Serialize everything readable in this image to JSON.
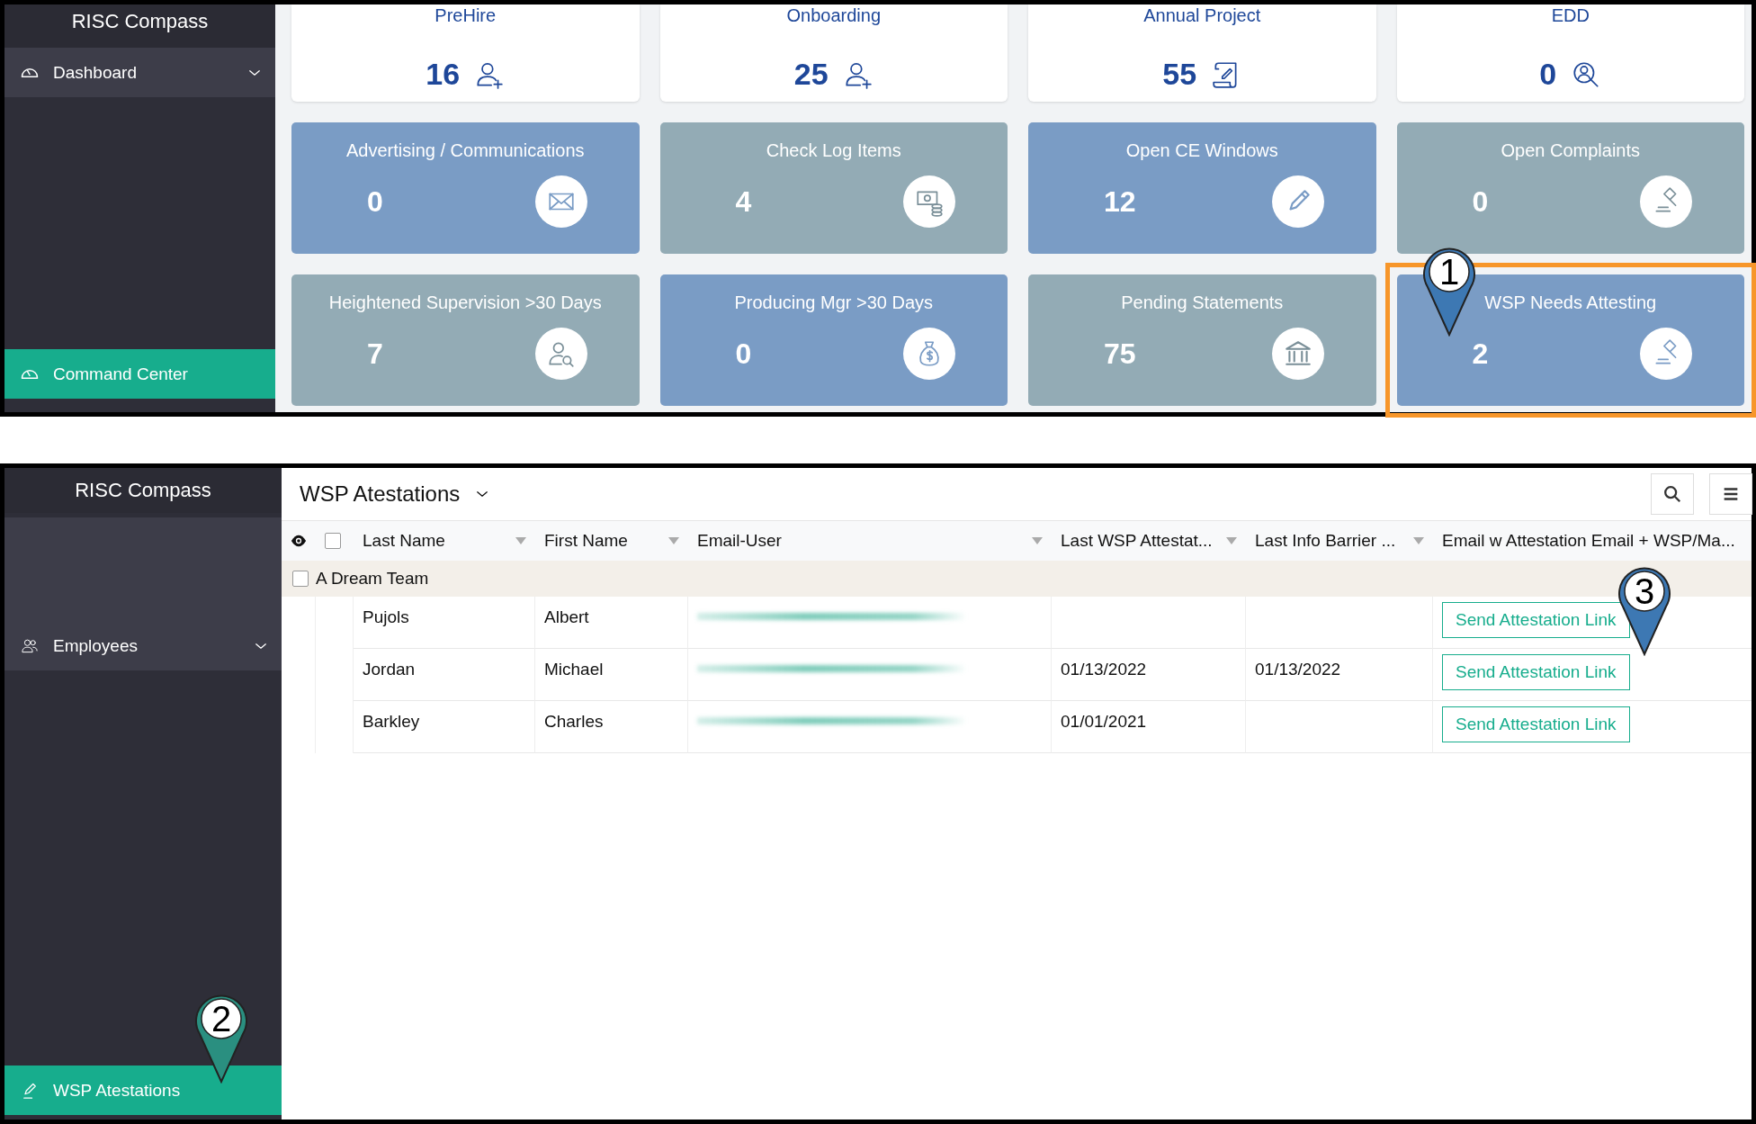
{
  "dashboard": {
    "app_title": "RISC Compass",
    "sidebar": [
      {
        "label": "Dashboard",
        "kind": "group",
        "selected": false
      },
      {
        "label": "Command Center",
        "kind": "link",
        "selected": true
      }
    ],
    "tiles": [
      {
        "title": "PreHire",
        "count": "16",
        "kind": "summary",
        "highlighted": false
      },
      {
        "title": "Onboarding",
        "count": "25",
        "kind": "summary",
        "highlighted": false
      },
      {
        "title": "Annual Project",
        "count": "55",
        "kind": "summary",
        "highlighted": false
      },
      {
        "title": "EDD",
        "count": "0",
        "kind": "summary",
        "highlighted": false
      },
      {
        "title": "Advertising / Communications",
        "count": "0",
        "kind": "tile",
        "color": "#7a9cc5",
        "highlighted": false
      },
      {
        "title": "Check Log Items",
        "count": "4",
        "kind": "tile",
        "color": "#93abb5",
        "highlighted": false
      },
      {
        "title": "Open CE Windows",
        "count": "12",
        "kind": "tile",
        "color": "#7a9cc5",
        "highlighted": false
      },
      {
        "title": "Open Complaints",
        "count": "0",
        "kind": "tile",
        "color": "#93abb5",
        "highlighted": false
      },
      {
        "title": "Heightened Supervision >30 Days",
        "count": "7",
        "kind": "tile",
        "color": "#93abb5",
        "highlighted": false
      },
      {
        "title": "Producing Mgr >30 Days",
        "count": "0",
        "kind": "tile",
        "color": "#7a9cc5",
        "highlighted": false
      },
      {
        "title": "Pending Statements",
        "count": "75",
        "kind": "tile",
        "color": "#93abb5",
        "highlighted": false
      },
      {
        "title": "WSP Needs Attesting",
        "count": "2",
        "kind": "tile",
        "color": "#7a9cc5",
        "highlighted": true
      }
    ]
  },
  "attestations": {
    "app_title": "RISC Compass",
    "sidebar": [
      {
        "label": "Employees",
        "kind": "group",
        "selected": false
      },
      {
        "label": "WSP Atestations",
        "kind": "link",
        "selected": true
      }
    ],
    "title": "WSP Atestations",
    "select_all_checked": false,
    "columns": [
      {
        "label": "Last Name",
        "sortable": true
      },
      {
        "label": "First Name",
        "sortable": true
      },
      {
        "label": "Email-User",
        "sortable": true
      },
      {
        "label": "Last WSP Attestat...",
        "sortable": true
      },
      {
        "label": "Last Info Barrier ...",
        "sortable": true
      },
      {
        "label": "Email w Attestation Email + WSP/Ma...",
        "sortable": false
      }
    ],
    "group": {
      "label": "A Dream Team",
      "checked": false
    },
    "rows": [
      {
        "last_name": "Pujols",
        "first_name": "Albert",
        "action": "Send Attestation Link"
      },
      {
        "last_name": "Jordan",
        "first_name": "Michael",
        "last_wsp": "01/13/2022",
        "last_info": "01/13/2022",
        "action": "Send Attestation Link"
      },
      {
        "last_name": "Barkley",
        "first_name": "Charles",
        "last_wsp": "01/01/2021",
        "action": "Send Attestation Link"
      }
    ]
  },
  "annotations": [
    {
      "label": "1",
      "color": "#3d78b3"
    },
    {
      "label": "2",
      "color": "#2a8f80"
    },
    {
      "label": "3",
      "color": "#3d78b3"
    }
  ]
}
